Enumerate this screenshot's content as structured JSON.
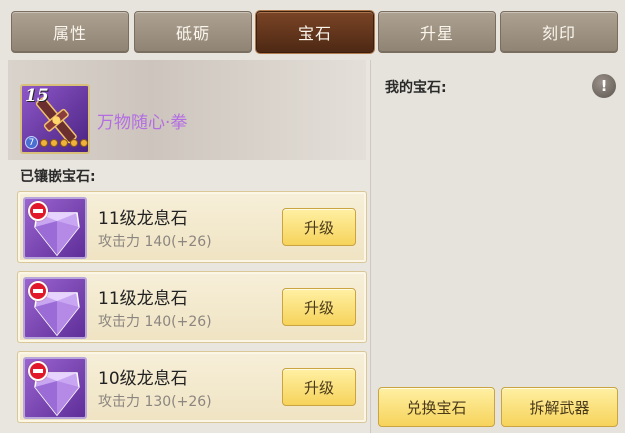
{
  "tabs": [
    {
      "label": "属性",
      "active": false
    },
    {
      "label": "砥砺",
      "active": false
    },
    {
      "label": "宝石",
      "active": true
    },
    {
      "label": "升星",
      "active": false
    },
    {
      "label": "刻印",
      "active": false
    }
  ],
  "weapon": {
    "level": "15",
    "star": "7",
    "name": "万物随心·拳",
    "icon": "fist-weapon-icon"
  },
  "embedded": {
    "label": "已镶嵌宝石:",
    "gems": [
      {
        "name": "11级龙息石",
        "stat": "攻击力 140(+26)",
        "button": "升级",
        "icon": "dragon-breath-gem-icon"
      },
      {
        "name": "11级龙息石",
        "stat": "攻击力 140(+26)",
        "button": "升级",
        "icon": "dragon-breath-gem-icon"
      },
      {
        "name": "10级龙息石",
        "stat": "攻击力 130(+26)",
        "button": "升级",
        "icon": "dragon-breath-gem-icon"
      }
    ]
  },
  "my_gems": {
    "label": "我的宝石:",
    "info": "!"
  },
  "actions": {
    "exchange": "兑换宝石",
    "dismantle": "拆解武器"
  },
  "colors": {
    "active_tab": "#5e331b",
    "tab": "#9c9080",
    "button_gold": "#f6d35b",
    "weapon_name": "#b36ee2",
    "remove": "#e0182a"
  }
}
